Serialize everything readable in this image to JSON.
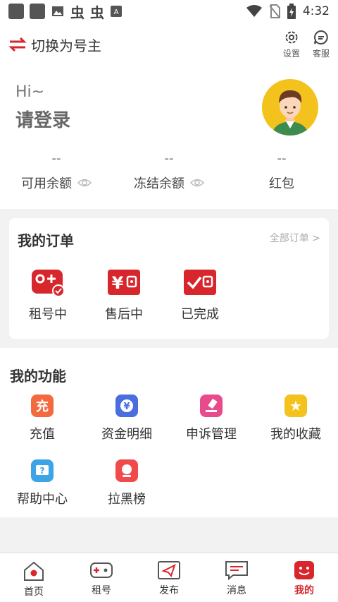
{
  "statusbar": {
    "time": "4:32"
  },
  "topbar": {
    "switch_label": "切换为号主",
    "settings_label": "设置",
    "service_label": "客服"
  },
  "profile": {
    "greeting": "Hi~",
    "login_prompt": "请登录",
    "balances": [
      {
        "value": "--",
        "label": "可用余额",
        "has_eye": true
      },
      {
        "value": "--",
        "label": "冻结余额",
        "has_eye": true
      },
      {
        "value": "--",
        "label": "红包",
        "has_eye": false
      }
    ]
  },
  "orders": {
    "title": "我的订单",
    "all_link": "全部订单 >",
    "items": [
      {
        "label": "租号中",
        "icon": "gamepad-check-icon"
      },
      {
        "label": "售后中",
        "icon": "yuan-wallet-icon"
      },
      {
        "label": "已完成",
        "icon": "check-wallet-icon"
      }
    ]
  },
  "features": {
    "title": "我的功能",
    "items": [
      {
        "label": "充值",
        "icon": "recharge-icon",
        "icon_char": "充",
        "color": "#f26a3d"
      },
      {
        "label": "资金明细",
        "icon": "funds-detail-icon",
        "icon_char": "¥",
        "color": "#4a6ee0"
      },
      {
        "label": "申诉管理",
        "icon": "appeal-icon",
        "icon_char": "",
        "color": "#e94a8c"
      },
      {
        "label": "我的收藏",
        "icon": "favorites-icon",
        "icon_char": "★",
        "color": "#f4c21c"
      },
      {
        "label": "帮助中心",
        "icon": "help-center-icon",
        "icon_char": "?",
        "color": "#3da5e6"
      },
      {
        "label": "拉黑榜",
        "icon": "blacklist-icon",
        "icon_char": "",
        "color": "#f04a4a"
      }
    ]
  },
  "tabbar": {
    "items": [
      {
        "label": "首页",
        "icon": "home-icon",
        "active": false
      },
      {
        "label": "租号",
        "icon": "gamepad-icon",
        "active": false
      },
      {
        "label": "发布",
        "icon": "send-icon",
        "active": false
      },
      {
        "label": "消息",
        "icon": "message-icon",
        "active": false
      },
      {
        "label": "我的",
        "icon": "profile-face-icon",
        "active": true
      }
    ]
  },
  "colors": {
    "accent": "#d7262c"
  }
}
